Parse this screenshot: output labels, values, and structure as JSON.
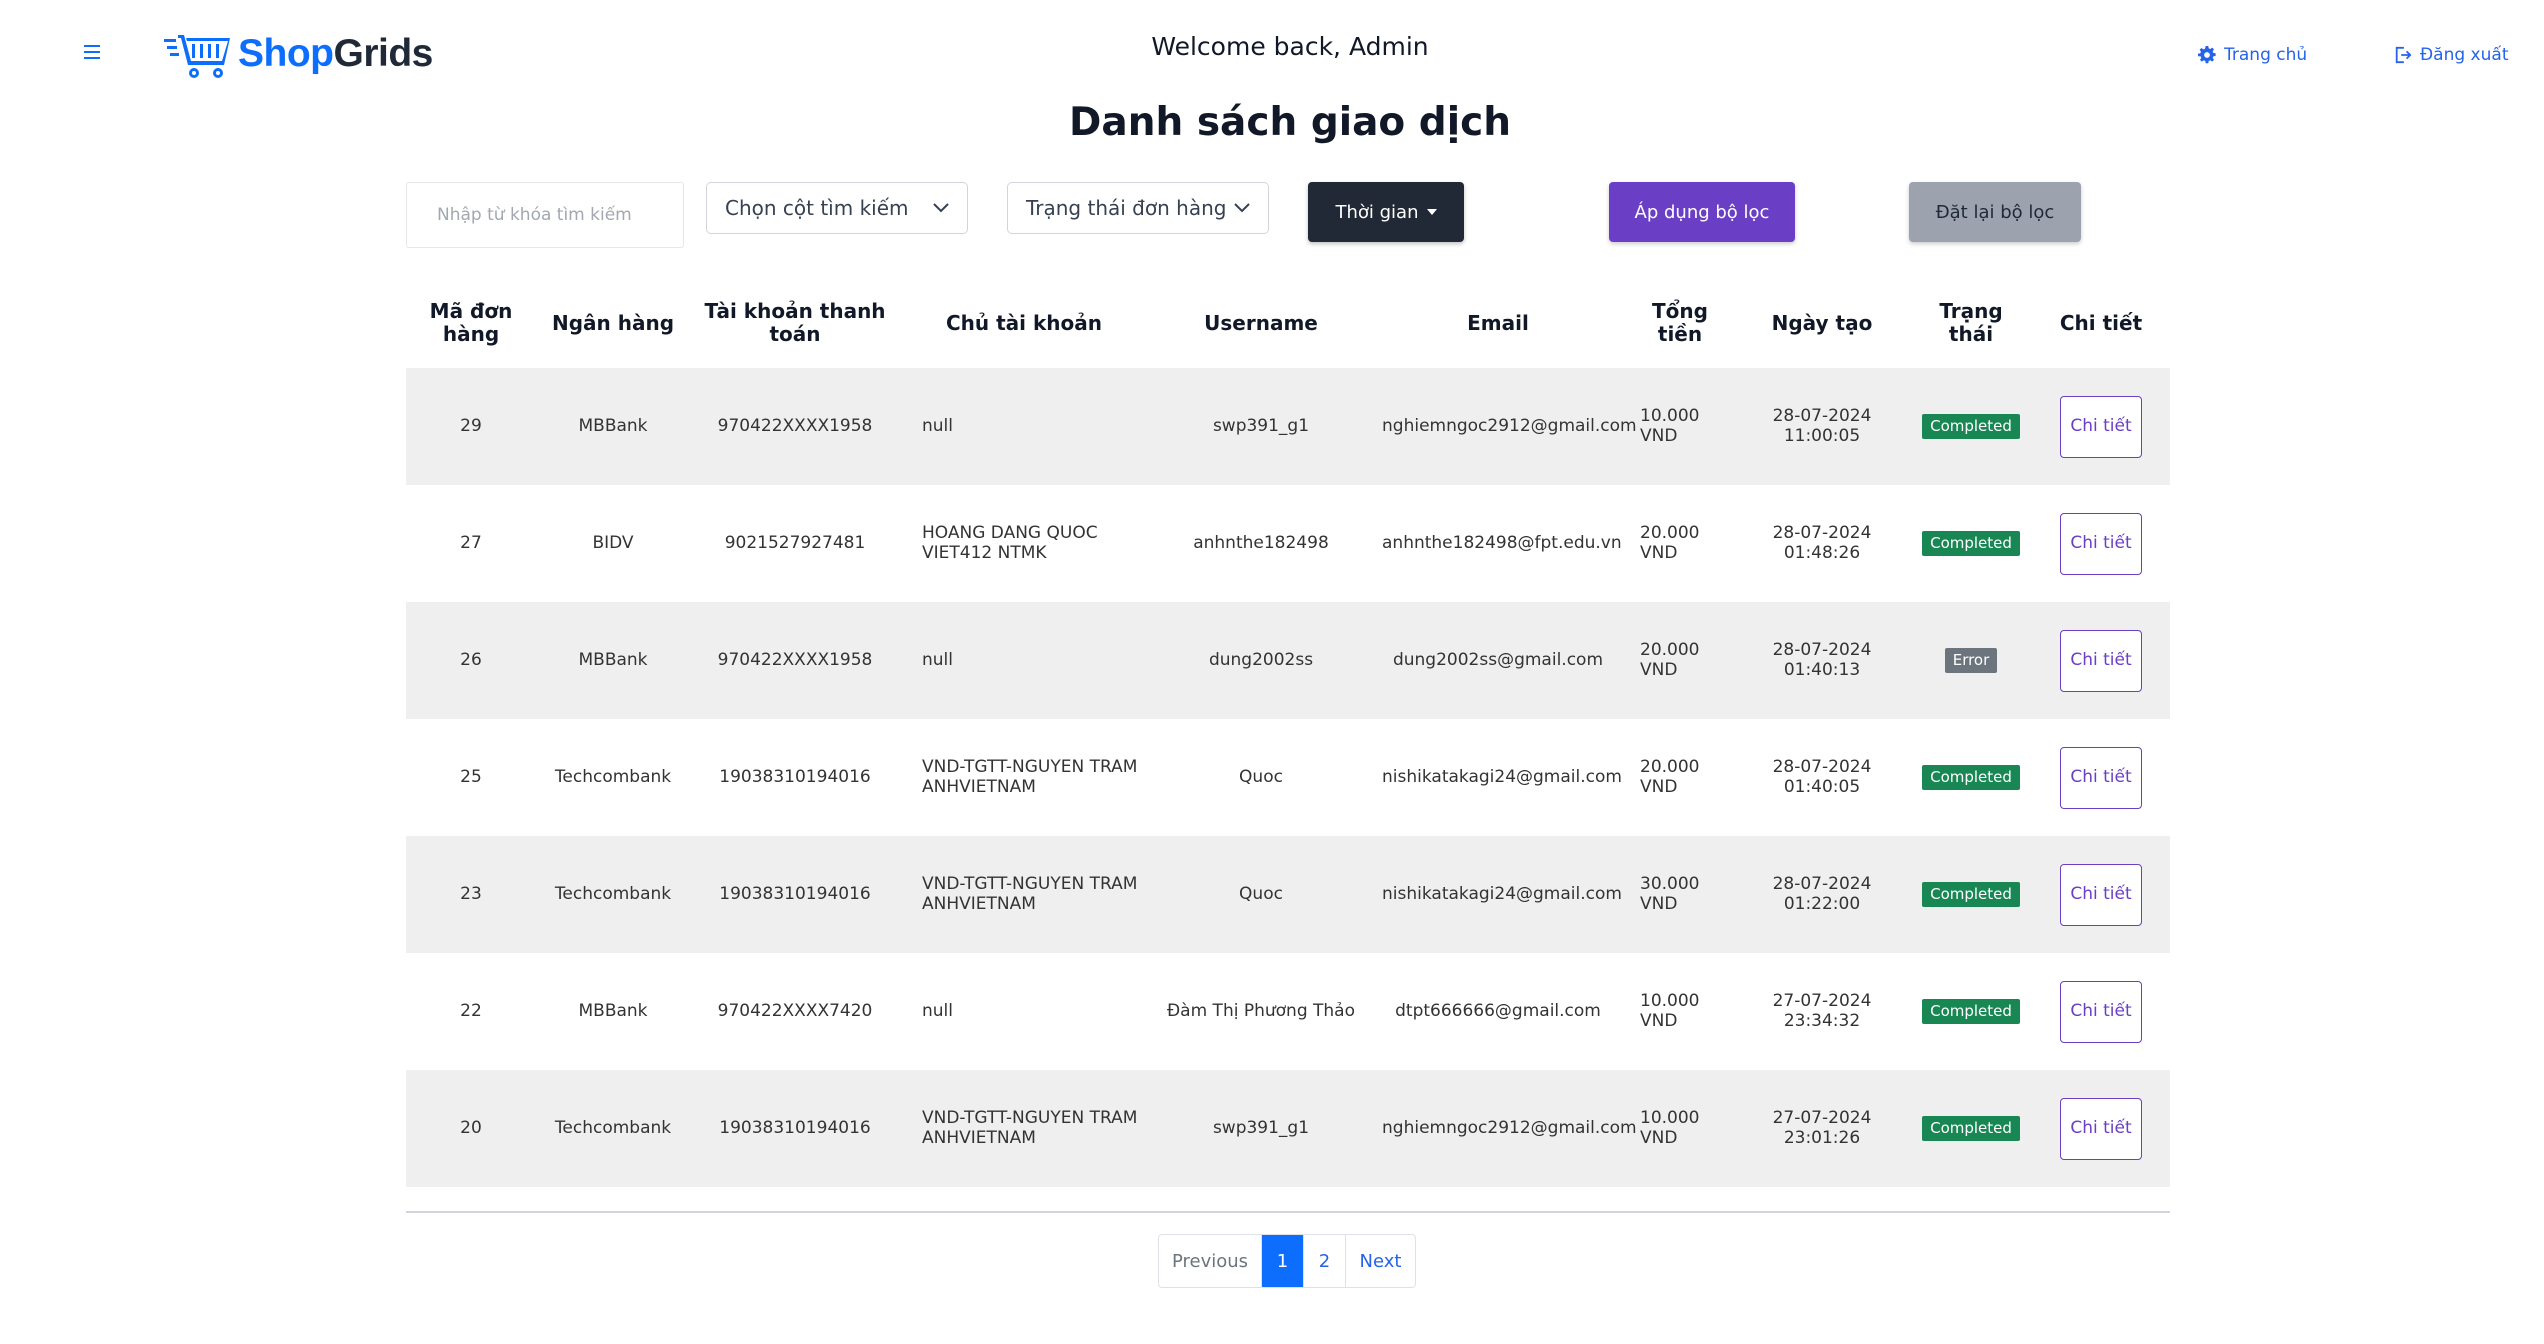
{
  "header": {
    "brand_part1": "Shop",
    "brand_part2": "Grids",
    "welcome": "Welcome back, Admin",
    "home_label": "Trang chủ",
    "logout_label": "Đăng xuất"
  },
  "page_title": "Danh sách giao dịch",
  "filters": {
    "search_placeholder": "Nhập từ khóa tìm kiếm",
    "column_select": "Chọn cột tìm kiếm",
    "status_select": "Trạng thái đơn hàng",
    "time_button": "Thời gian",
    "apply_button": "Áp dụng bộ lọc",
    "reset_button": "Đặt lại bộ lọc"
  },
  "table": {
    "headers": {
      "id": "Mã đơn hàng",
      "bank": "Ngân hàng",
      "account": "Tài khoản thanh toán",
      "owner": "Chủ tài khoản",
      "username": "Username",
      "email": "Email",
      "total": "Tổng tiền",
      "created": "Ngày tạo",
      "status": "Trạng thái",
      "detail": "Chi tiết"
    },
    "rows": [
      {
        "id": "29",
        "bank": "MBBank",
        "account": "970422XXXX1958",
        "owner": "null",
        "username": "swp391_g1",
        "email": "nghiemngoc2912@gmail.com",
        "total": "10.000 VND",
        "created_date": "28-07-2024",
        "created_time": "11:00:05",
        "status": "Completed",
        "detail": "Chi tiết"
      },
      {
        "id": "27",
        "bank": "BIDV",
        "account": "9021527927481",
        "owner": "HOANG DANG QUOC VIET412 NTMK",
        "username": "anhnthe182498",
        "email": "anhnthe182498@fpt.edu.vn",
        "total": "20.000 VND",
        "created_date": "28-07-2024",
        "created_time": "01:48:26",
        "status": "Completed",
        "detail": "Chi tiết"
      },
      {
        "id": "26",
        "bank": "MBBank",
        "account": "970422XXXX1958",
        "owner": "null",
        "username": "dung2002ss",
        "email": "dung2002ss@gmail.com",
        "total": "20.000 VND",
        "created_date": "28-07-2024",
        "created_time": "01:40:13",
        "status": "Error",
        "detail": "Chi tiết"
      },
      {
        "id": "25",
        "bank": "Techcombank",
        "account": "19038310194016",
        "owner": "VND-TGTT-NGUYEN TRAM ANHVIETNAM",
        "username": "Quoc",
        "email": "nishikatakagi24@gmail.com",
        "total": "20.000 VND",
        "created_date": "28-07-2024",
        "created_time": "01:40:05",
        "status": "Completed",
        "detail": "Chi tiết"
      },
      {
        "id": "23",
        "bank": "Techcombank",
        "account": "19038310194016",
        "owner": "VND-TGTT-NGUYEN TRAM ANHVIETNAM",
        "username": "Quoc",
        "email": "nishikatakagi24@gmail.com",
        "total": "30.000 VND",
        "created_date": "28-07-2024",
        "created_time": "01:22:00",
        "status": "Completed",
        "detail": "Chi tiết"
      },
      {
        "id": "22",
        "bank": "MBBank",
        "account": "970422XXXX7420",
        "owner": "null",
        "username": "Đàm Thị Phương Thảo",
        "email": "dtpt666666@gmail.com",
        "total": "10.000 VND",
        "created_date": "27-07-2024",
        "created_time": "23:34:32",
        "status": "Completed",
        "detail": "Chi tiết"
      },
      {
        "id": "20",
        "bank": "Techcombank",
        "account": "19038310194016",
        "owner": "VND-TGTT-NGUYEN TRAM ANHVIETNAM",
        "username": "swp391_g1",
        "email": "nghiemngoc2912@gmail.com",
        "total": "10.000 VND",
        "created_date": "27-07-2024",
        "created_time": "23:01:26",
        "status": "Completed",
        "detail": "Chi tiết"
      }
    ]
  },
  "pagination": {
    "previous": "Previous",
    "pages": [
      "1",
      "2"
    ],
    "active_page": "1",
    "next": "Next"
  },
  "colors": {
    "brand_blue": "#0d6efd",
    "purple": "#6a3fc6",
    "completed": "#198754",
    "error": "#6c757d"
  }
}
